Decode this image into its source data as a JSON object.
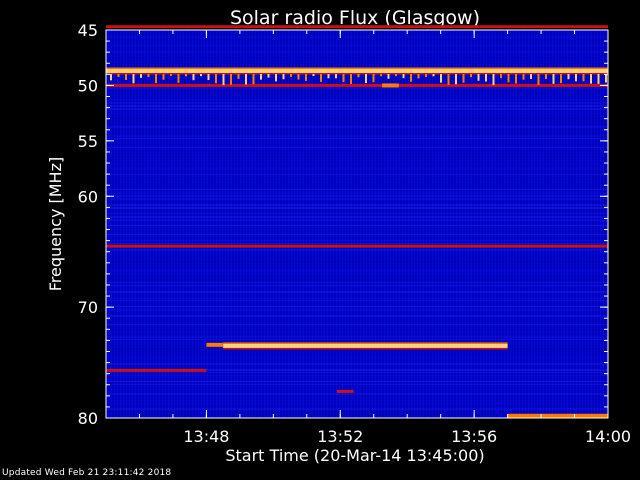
{
  "chart_data": {
    "type": "heatmap",
    "title": "Solar radio Flux (Glasgow)",
    "xlabel": "Start Time (20-Mar-14 13:45:00)",
    "ylabel": "Frequency [MHz]",
    "x_unit": "minutes after 13:45:00",
    "xlim": [
      0,
      15
    ],
    "ylim": [
      45,
      80
    ],
    "x_ticks": [
      {
        "value": 3,
        "label": "13:48"
      },
      {
        "value": 7,
        "label": "13:52"
      },
      {
        "value": 11,
        "label": "13:56"
      },
      {
        "value": 15,
        "label": "14:00"
      }
    ],
    "y_ticks": [
      {
        "value": 45,
        "label": "45"
      },
      {
        "value": 50,
        "label": "50"
      },
      {
        "value": 55,
        "label": "55"
      },
      {
        "value": 60,
        "label": "60"
      },
      {
        "value": 70,
        "label": "70"
      },
      {
        "value": 80,
        "label": "80"
      }
    ],
    "colors": {
      "background": "#0000c8",
      "strong": "#ffd27a",
      "medium": "#ff7a00",
      "weak": "#cc1010"
    },
    "bands": [
      {
        "freq": 44.7,
        "x_start": 0,
        "x_end": 15,
        "level": "weak"
      },
      {
        "freq": 48.7,
        "x_start": 0,
        "x_end": 15,
        "level": "strong"
      },
      {
        "freq": 50.0,
        "x_start": 0,
        "x_end": 15,
        "level": "weak"
      },
      {
        "freq": 50.0,
        "x_start": 8.25,
        "x_end": 8.75,
        "level": "medium"
      },
      {
        "freq": 64.5,
        "x_start": 0,
        "x_end": 15,
        "level": "weak"
      },
      {
        "freq": 73.4,
        "x_start": 3.0,
        "x_end": 3.5,
        "level": "medium"
      },
      {
        "freq": 73.5,
        "x_start": 3.5,
        "x_end": 12.0,
        "level": "strong"
      },
      {
        "freq": 75.7,
        "x_start": 0,
        "x_end": 3.0,
        "level": "weak"
      },
      {
        "freq": 77.6,
        "x_start": 6.9,
        "x_end": 7.4,
        "level": "weak"
      },
      {
        "freq": 79.8,
        "x_start": 12.0,
        "x_end": 15,
        "level": "medium"
      }
    ]
  },
  "footer": {
    "text": "Updated Wed Feb 21 23:11:42 2018"
  }
}
